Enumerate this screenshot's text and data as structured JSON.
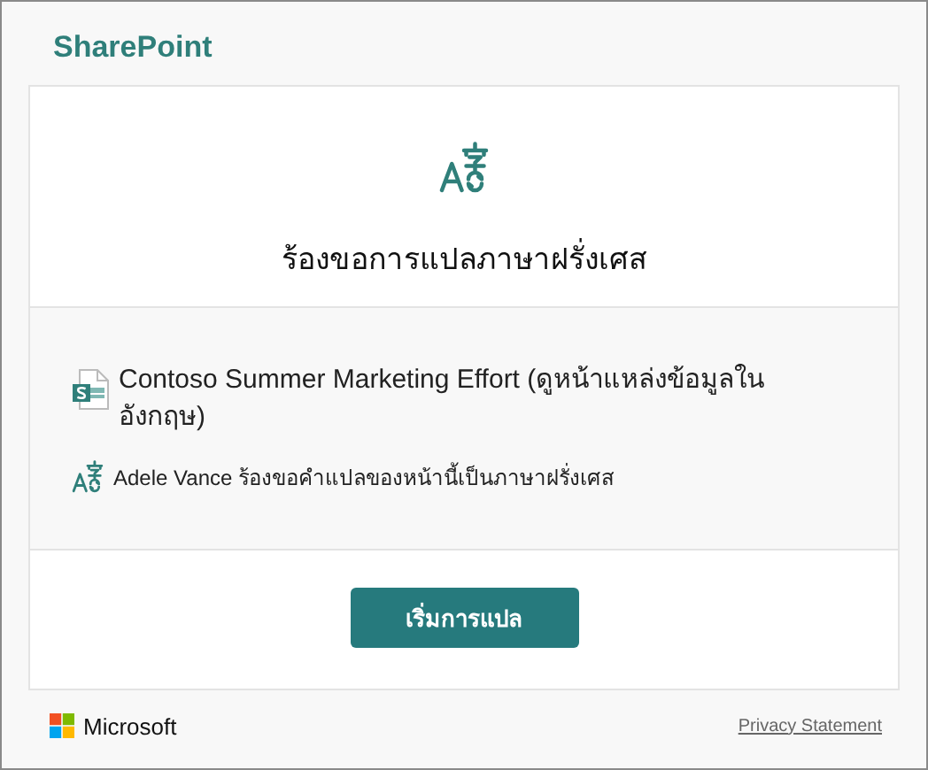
{
  "header": {
    "title": "SharePoint"
  },
  "request": {
    "title": "ร้องขอการแปลภาษาฝรั่งเศส"
  },
  "details": [
    {
      "kind": "page",
      "text": "Contoso Summer Marketing Effort (ดูหน้าแหล่งข้อมูลในอังกฤษ)"
    },
    {
      "kind": "translate",
      "text": "Adele Vance ร้องขอคำแปลของหน้านี้เป็นภาษาฝรั่งเศส"
    }
  ],
  "action": {
    "label": "เริ่มการแปล"
  },
  "footer": {
    "brand": "Microsoft",
    "link": "Privacy Statement"
  }
}
